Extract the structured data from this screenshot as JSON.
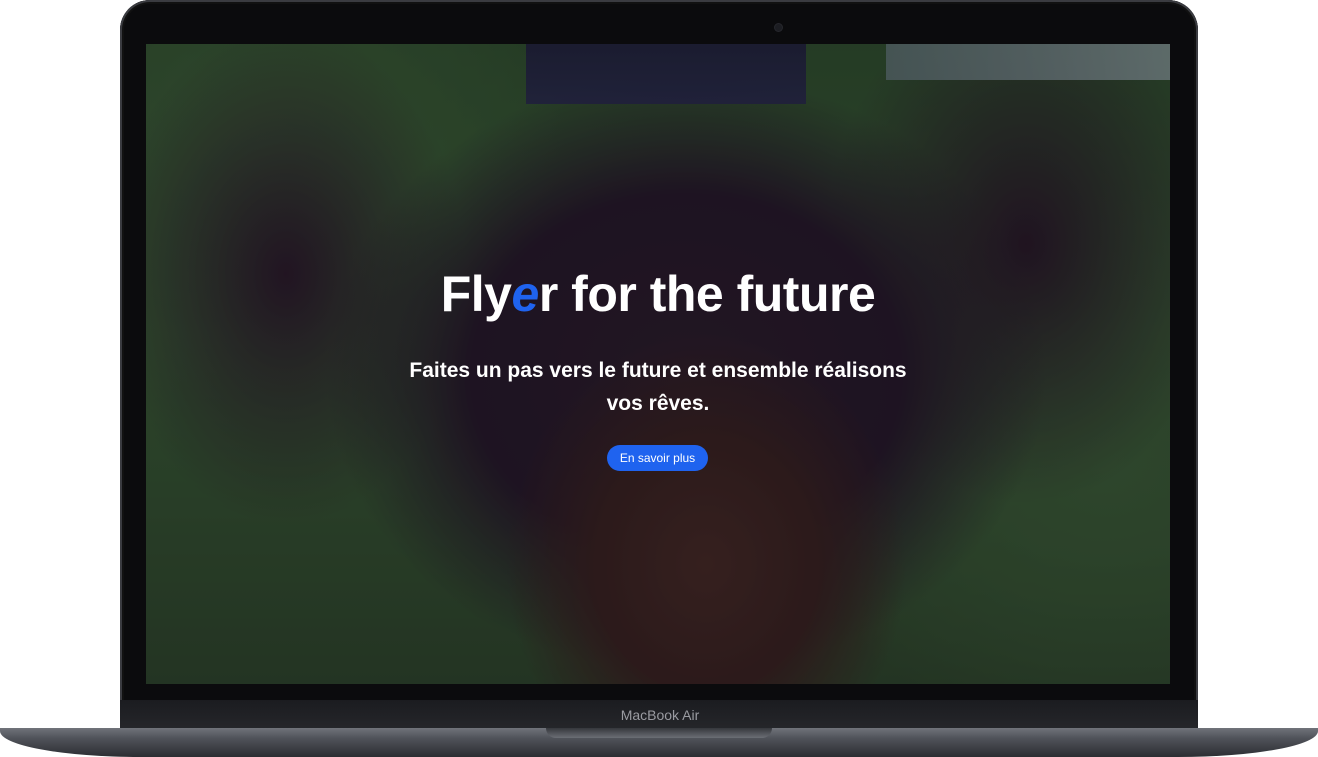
{
  "hero": {
    "title_part1": "Fly",
    "title_accent": "e",
    "title_part2": "r for the future",
    "subtitle": "Faites un pas vers le future et ensemble réalisons vos rêves.",
    "cta_label": "En savoir plus"
  },
  "device": {
    "label": "MacBook Air"
  },
  "colors": {
    "accent": "#1f63ef",
    "text": "#ffffff",
    "bezel": "#0b0b0d"
  }
}
